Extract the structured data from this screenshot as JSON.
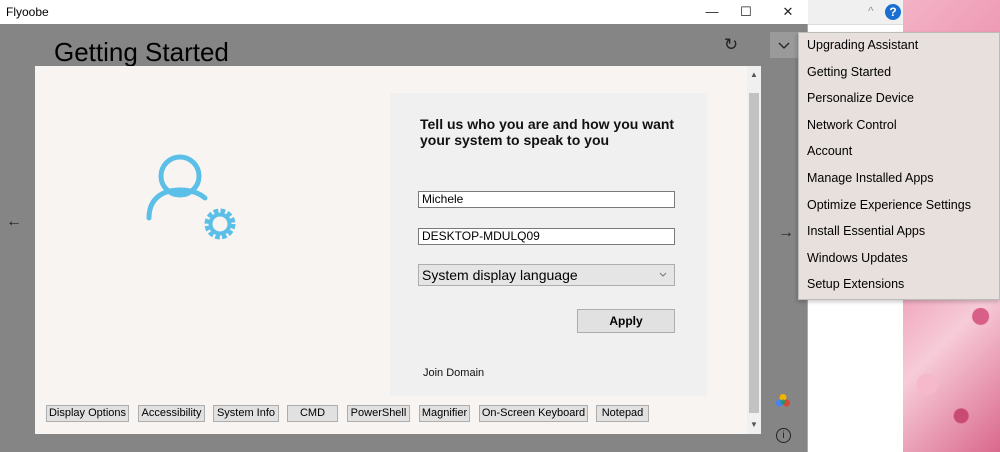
{
  "window": {
    "title": "Flyoobe",
    "minimize_symbol": "—",
    "maximize_symbol": "☐",
    "close_symbol": "✕"
  },
  "header": {
    "page_title": "Getting Started",
    "refresh_icon": "↻",
    "menu_toggle_icon": "⌄"
  },
  "nav": {
    "back_icon": "←",
    "forward_icon": "→",
    "info_icon": "i"
  },
  "form": {
    "heading": "Tell us who you are and how you want your system to speak to you",
    "user_name": "Michele",
    "computer_name": "DESKTOP-MDULQ09",
    "language_select": "System display language",
    "apply_label": "Apply",
    "join_domain": "Join Domain"
  },
  "tools": [
    "Display Options",
    "Accessibility",
    "System Info",
    "CMD",
    "PowerShell",
    "Magnifier",
    "On-Screen Keyboard",
    "Notepad"
  ],
  "menu": {
    "items": [
      "Upgrading Assistant",
      "Getting Started",
      "Personalize Device",
      "Network Control",
      "Account",
      "Manage Installed Apps",
      "Optimize Experience Settings",
      "Install Essential Apps",
      "Windows Updates",
      "Setup Extensions"
    ]
  },
  "background": {
    "help_icon": "?",
    "caret_icon": "^"
  },
  "colors": {
    "accent_icon": "#5bbfe8",
    "client_bg": "#858585",
    "panel_bg": "#f8f4f1",
    "menu_bg": "#e8e0dc"
  }
}
